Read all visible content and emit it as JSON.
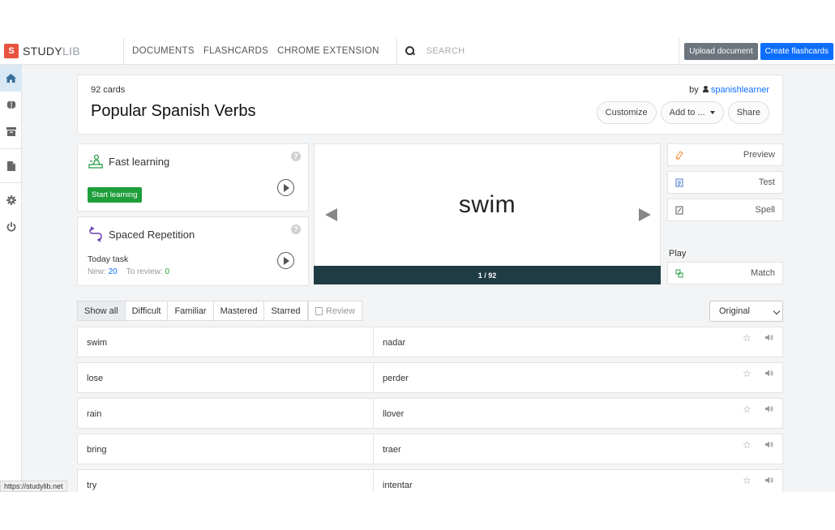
{
  "brand": {
    "logo_letter": "S",
    "name_a": "STUDY",
    "name_b": "LIB"
  },
  "nav": [
    "DOCUMENTS",
    "FLASHCARDS",
    "CHROME EXTENSION"
  ],
  "search": {
    "placeholder": "SEARCH"
  },
  "buttons": {
    "upload": "Upload document",
    "create": "Create flashcards"
  },
  "set": {
    "count": "92 cards",
    "title": "Popular Spanish Verbs",
    "by": "by",
    "author": "spanishlearner",
    "actions": {
      "customize": "Customize",
      "add_to": "Add to ...",
      "share": "Share"
    }
  },
  "fast_learning": {
    "title": "Fast learning",
    "start": "Start learning"
  },
  "spaced": {
    "title": "Spaced Repetition",
    "today": "Today task",
    "new_label": "New:",
    "new_value": "20",
    "review_label": "To review:",
    "review_value": "0"
  },
  "flashcard": {
    "word": "swim",
    "progress": "1 / 92"
  },
  "study_modes": {
    "preview": "Preview",
    "test": "Test",
    "spell": "Spell",
    "play_label": "Play",
    "match": "Match"
  },
  "filters": {
    "tabs": [
      "Show all",
      "Difficult",
      "Familiar",
      "Mastered",
      "Starred"
    ],
    "review": "Review",
    "order": "Original"
  },
  "cards": [
    {
      "term": "swim",
      "definition": "nadar"
    },
    {
      "term": "lose",
      "definition": "perder"
    },
    {
      "term": "rain",
      "definition": "llover"
    },
    {
      "term": "bring",
      "definition": "traer"
    },
    {
      "term": "try",
      "definition": "intentar"
    }
  ],
  "status_url": "https://studylib.net",
  "colors": {
    "primary": "#0d6efd",
    "success": "#1e9e3a",
    "progress_bar": "#1f3b44",
    "logo": "#e8533f"
  }
}
